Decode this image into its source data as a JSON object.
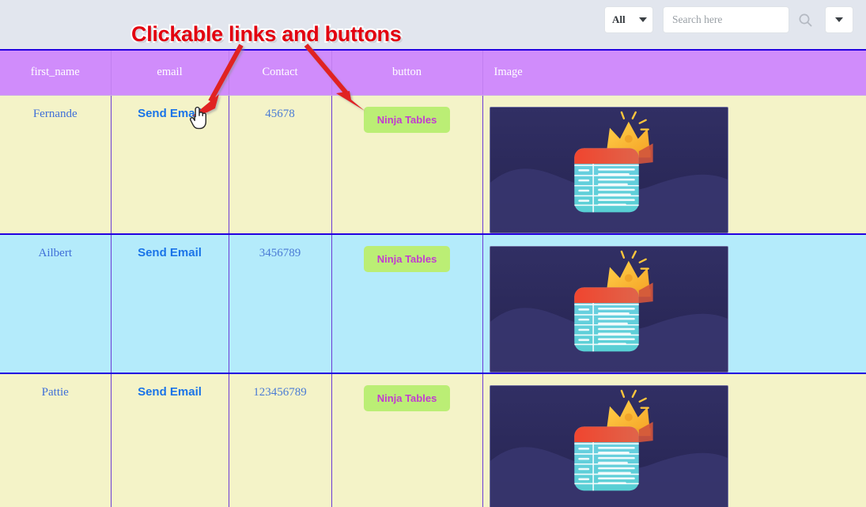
{
  "search": {
    "scope_label": "All",
    "placeholder": "Search here",
    "value": "",
    "search_icon": "search-icon",
    "caret_icon": "chevron-down-icon",
    "scope_caret_icon": "chevron-down-icon"
  },
  "annotation": {
    "text": "Clickable links and buttons",
    "color": "#e3000f",
    "arrow_color": "#e02020"
  },
  "table": {
    "columns": [
      {
        "key": "first_name",
        "label": "first_name"
      },
      {
        "key": "email",
        "label": "email"
      },
      {
        "key": "contact",
        "label": "Contact"
      },
      {
        "key": "button",
        "label": "button"
      },
      {
        "key": "image",
        "label": "Image"
      }
    ],
    "header_bg": "#d08cfb",
    "row_bg_odd": "#f4f3c8",
    "row_bg_even": "#b4ebfb",
    "border_color": "#2400e0",
    "rows": [
      {
        "first_name": "Fernande",
        "email_link_label": "Send Email",
        "contact": "45678",
        "button_label": "Ninja Tables",
        "image_alt": "ninja-tables-crown-logo"
      },
      {
        "first_name": "Ailbert",
        "email_link_label": "Send Email",
        "contact": "3456789",
        "button_label": "Ninja Tables",
        "image_alt": "ninja-tables-crown-logo"
      },
      {
        "first_name": "Pattie",
        "email_link_label": "Send Email",
        "contact": "123456789",
        "button_label": "Ninja Tables",
        "image_alt": "ninja-tables-crown-logo"
      }
    ]
  },
  "styles": {
    "button_bg": "#bbee75",
    "button_text_color": "#c23bd0",
    "link_color": "#1a74e8"
  }
}
